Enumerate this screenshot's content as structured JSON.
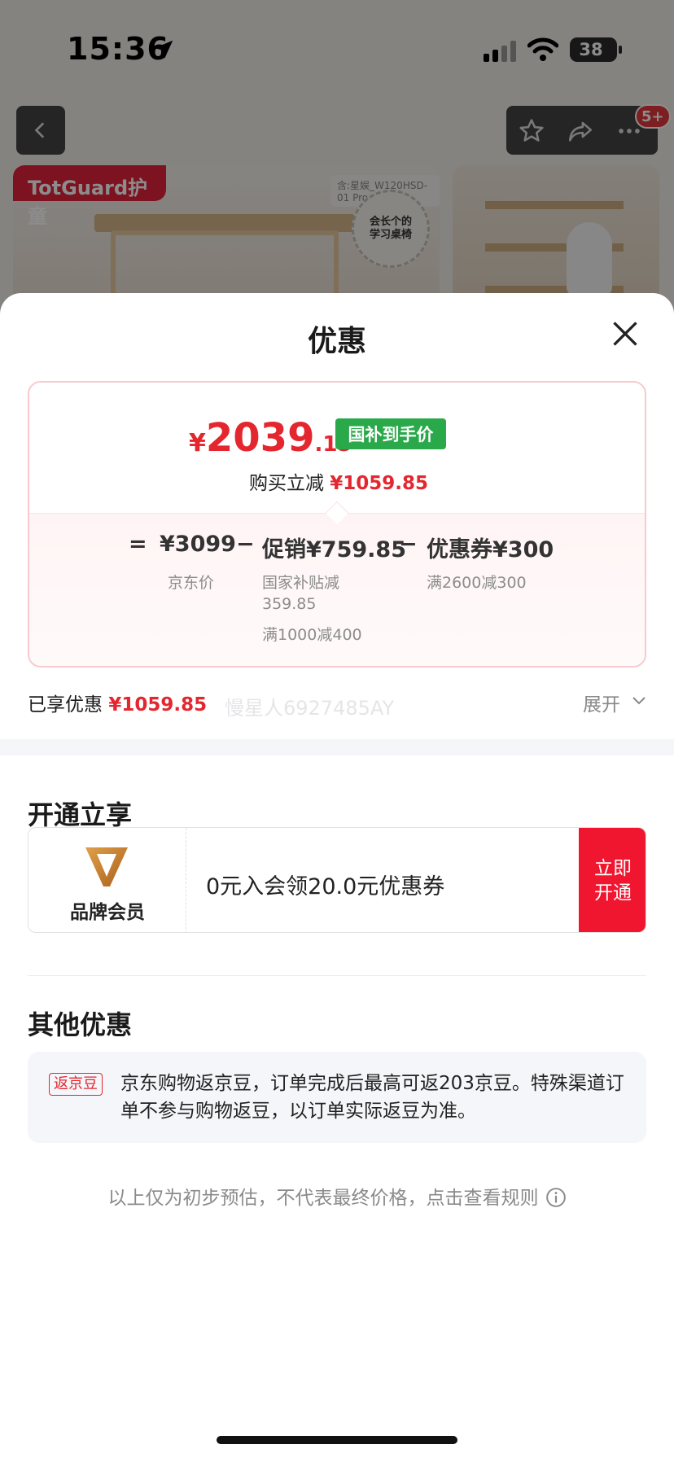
{
  "status_bar": {
    "time": "15:36",
    "battery": "38"
  },
  "header": {
    "notification_badge": "5+"
  },
  "product": {
    "brand": "TotGuard护童",
    "model_note": "含:星娱_W120HSD-01 Pro",
    "award_text": "会长个的\n学习桌椅"
  },
  "sheet": {
    "title": "优惠",
    "price_card": {
      "final_price_symbol": "¥",
      "final_price_int": "2039",
      "final_price_dec": ".15",
      "subsidy_tag": "国补到手价",
      "reduce_label": "购买立减",
      "reduce_amount": "¥1059.85",
      "equals": "=",
      "jd_price": "¥3099",
      "jd_price_label": "京东价",
      "minus1": "−",
      "promo": "促销¥759.85",
      "promo_detail1": "国家补贴减",
      "promo_detail1b": "359.85",
      "promo_detail2": "满1000减400",
      "minus2": "−",
      "coupon": "优惠券¥300",
      "coupon_detail": "满2600减300"
    },
    "enjoyed_label": "已享优惠",
    "enjoyed_amount": "¥1059.85",
    "watermark": "慢星人6927485AY",
    "expand_label": "展开",
    "member_section": {
      "title": "开通立享",
      "member_label": "品牌会员",
      "offer": "0元入会领20.0元优惠券",
      "button": "立即\n开通"
    },
    "other_section": {
      "title": "其他优惠",
      "tag": "返京豆",
      "text": "京东购物返京豆，订单完成后最高可返203京豆。特殊渠道订单不参与购物返豆，以订单实际返豆为准。"
    },
    "note": "以上仅为初步预估，不代表最终价格，点击查看规则"
  },
  "colors": {
    "accent_red": "#e4262f",
    "subsidy_green": "#2aa94a",
    "member_gold": "#c8802c"
  }
}
